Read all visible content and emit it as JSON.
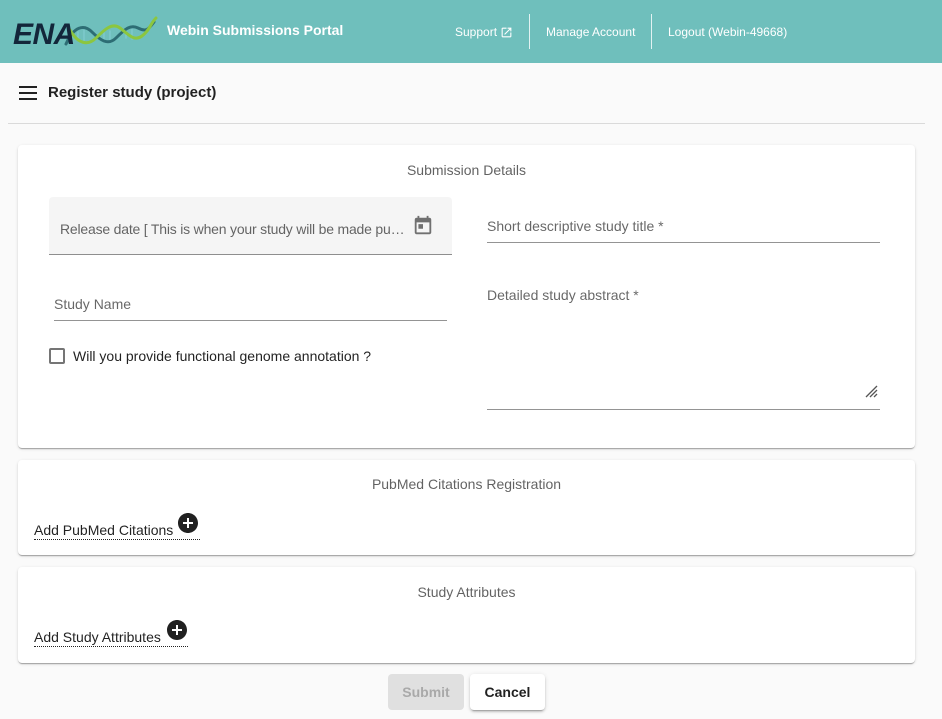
{
  "theme": {
    "header_bg": "#6fbfbc",
    "page_bg": "#fafafa",
    "logo_dark": "#13263a",
    "logo_green": "#8cc63f",
    "logo_teal": "#2d6d74"
  },
  "header": {
    "logo": {
      "text": "ENA",
      "icon": "dna-helix-icon"
    },
    "app_title": "Webin Submissions Portal",
    "nav": {
      "support": {
        "label": "Support",
        "icon": "external-link-icon"
      },
      "manage_account": {
        "label": "Manage Account"
      },
      "logout": {
        "label": "Logout (Webin-49668)"
      }
    }
  },
  "toolbar": {
    "menu_icon": "menu-icon",
    "page_title": "Register study (project)"
  },
  "submission_details": {
    "title": "Submission Details",
    "release_date": {
      "label": "Release date [ This is when your study will be made pu…",
      "value": "",
      "icon": "calendar-icon"
    },
    "study_title": {
      "label": "Short descriptive study title *",
      "value": ""
    },
    "study_name": {
      "label": "Study Name",
      "value": ""
    },
    "study_abstract": {
      "label": "Detailed study abstract *",
      "value": "",
      "resize_icon": "resize-handle-icon"
    },
    "functional_annotation": {
      "label": "Will you provide functional genome annotation ?",
      "checked": false
    }
  },
  "pubmed_citations": {
    "title": "PubMed Citations Registration",
    "add_label": "Add PubMed Citations",
    "add_icon": "add-circle-icon"
  },
  "study_attributes": {
    "title": "Study Attributes",
    "add_label": "Add Study Attributes",
    "add_icon": "add-circle-icon"
  },
  "actions": {
    "submit": {
      "label": "Submit",
      "disabled": true
    },
    "cancel": {
      "label": "Cancel"
    }
  }
}
